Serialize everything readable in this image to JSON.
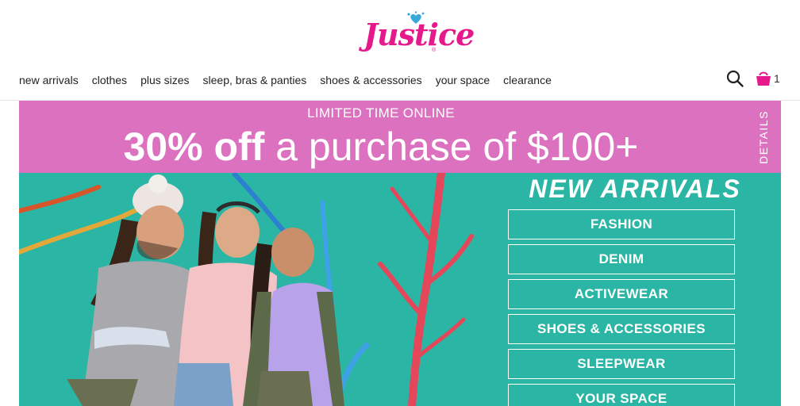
{
  "brand": {
    "name": "Justice",
    "reg": "®"
  },
  "nav": {
    "items": [
      {
        "label": "new arrivals"
      },
      {
        "label": "clothes"
      },
      {
        "label": "plus sizes"
      },
      {
        "label": "sleep, bras & panties"
      },
      {
        "label": "shoes & accessories"
      },
      {
        "label": "your space"
      },
      {
        "label": "clearance"
      }
    ]
  },
  "header": {
    "cart_count": "1",
    "icons": {
      "search": "search-icon",
      "cart": "shopping-bag-icon"
    }
  },
  "promo": {
    "eyebrow": "LIMITED TIME ONLINE",
    "headline_bold": "30% off",
    "headline_rest": " a purchase of $100+",
    "details": "DETAILS",
    "color": "#dc72bf"
  },
  "hero": {
    "bg_color": "#2bb5a4",
    "title": "NEW ARRIVALS",
    "categories": [
      {
        "label": "FASHION"
      },
      {
        "label": "DENIM"
      },
      {
        "label": "ACTIVEWEAR"
      },
      {
        "label": "SHOES & ACCESSORIES"
      },
      {
        "label": "SLEEPWEAR"
      },
      {
        "label": "YOUR SPACE"
      }
    ]
  }
}
